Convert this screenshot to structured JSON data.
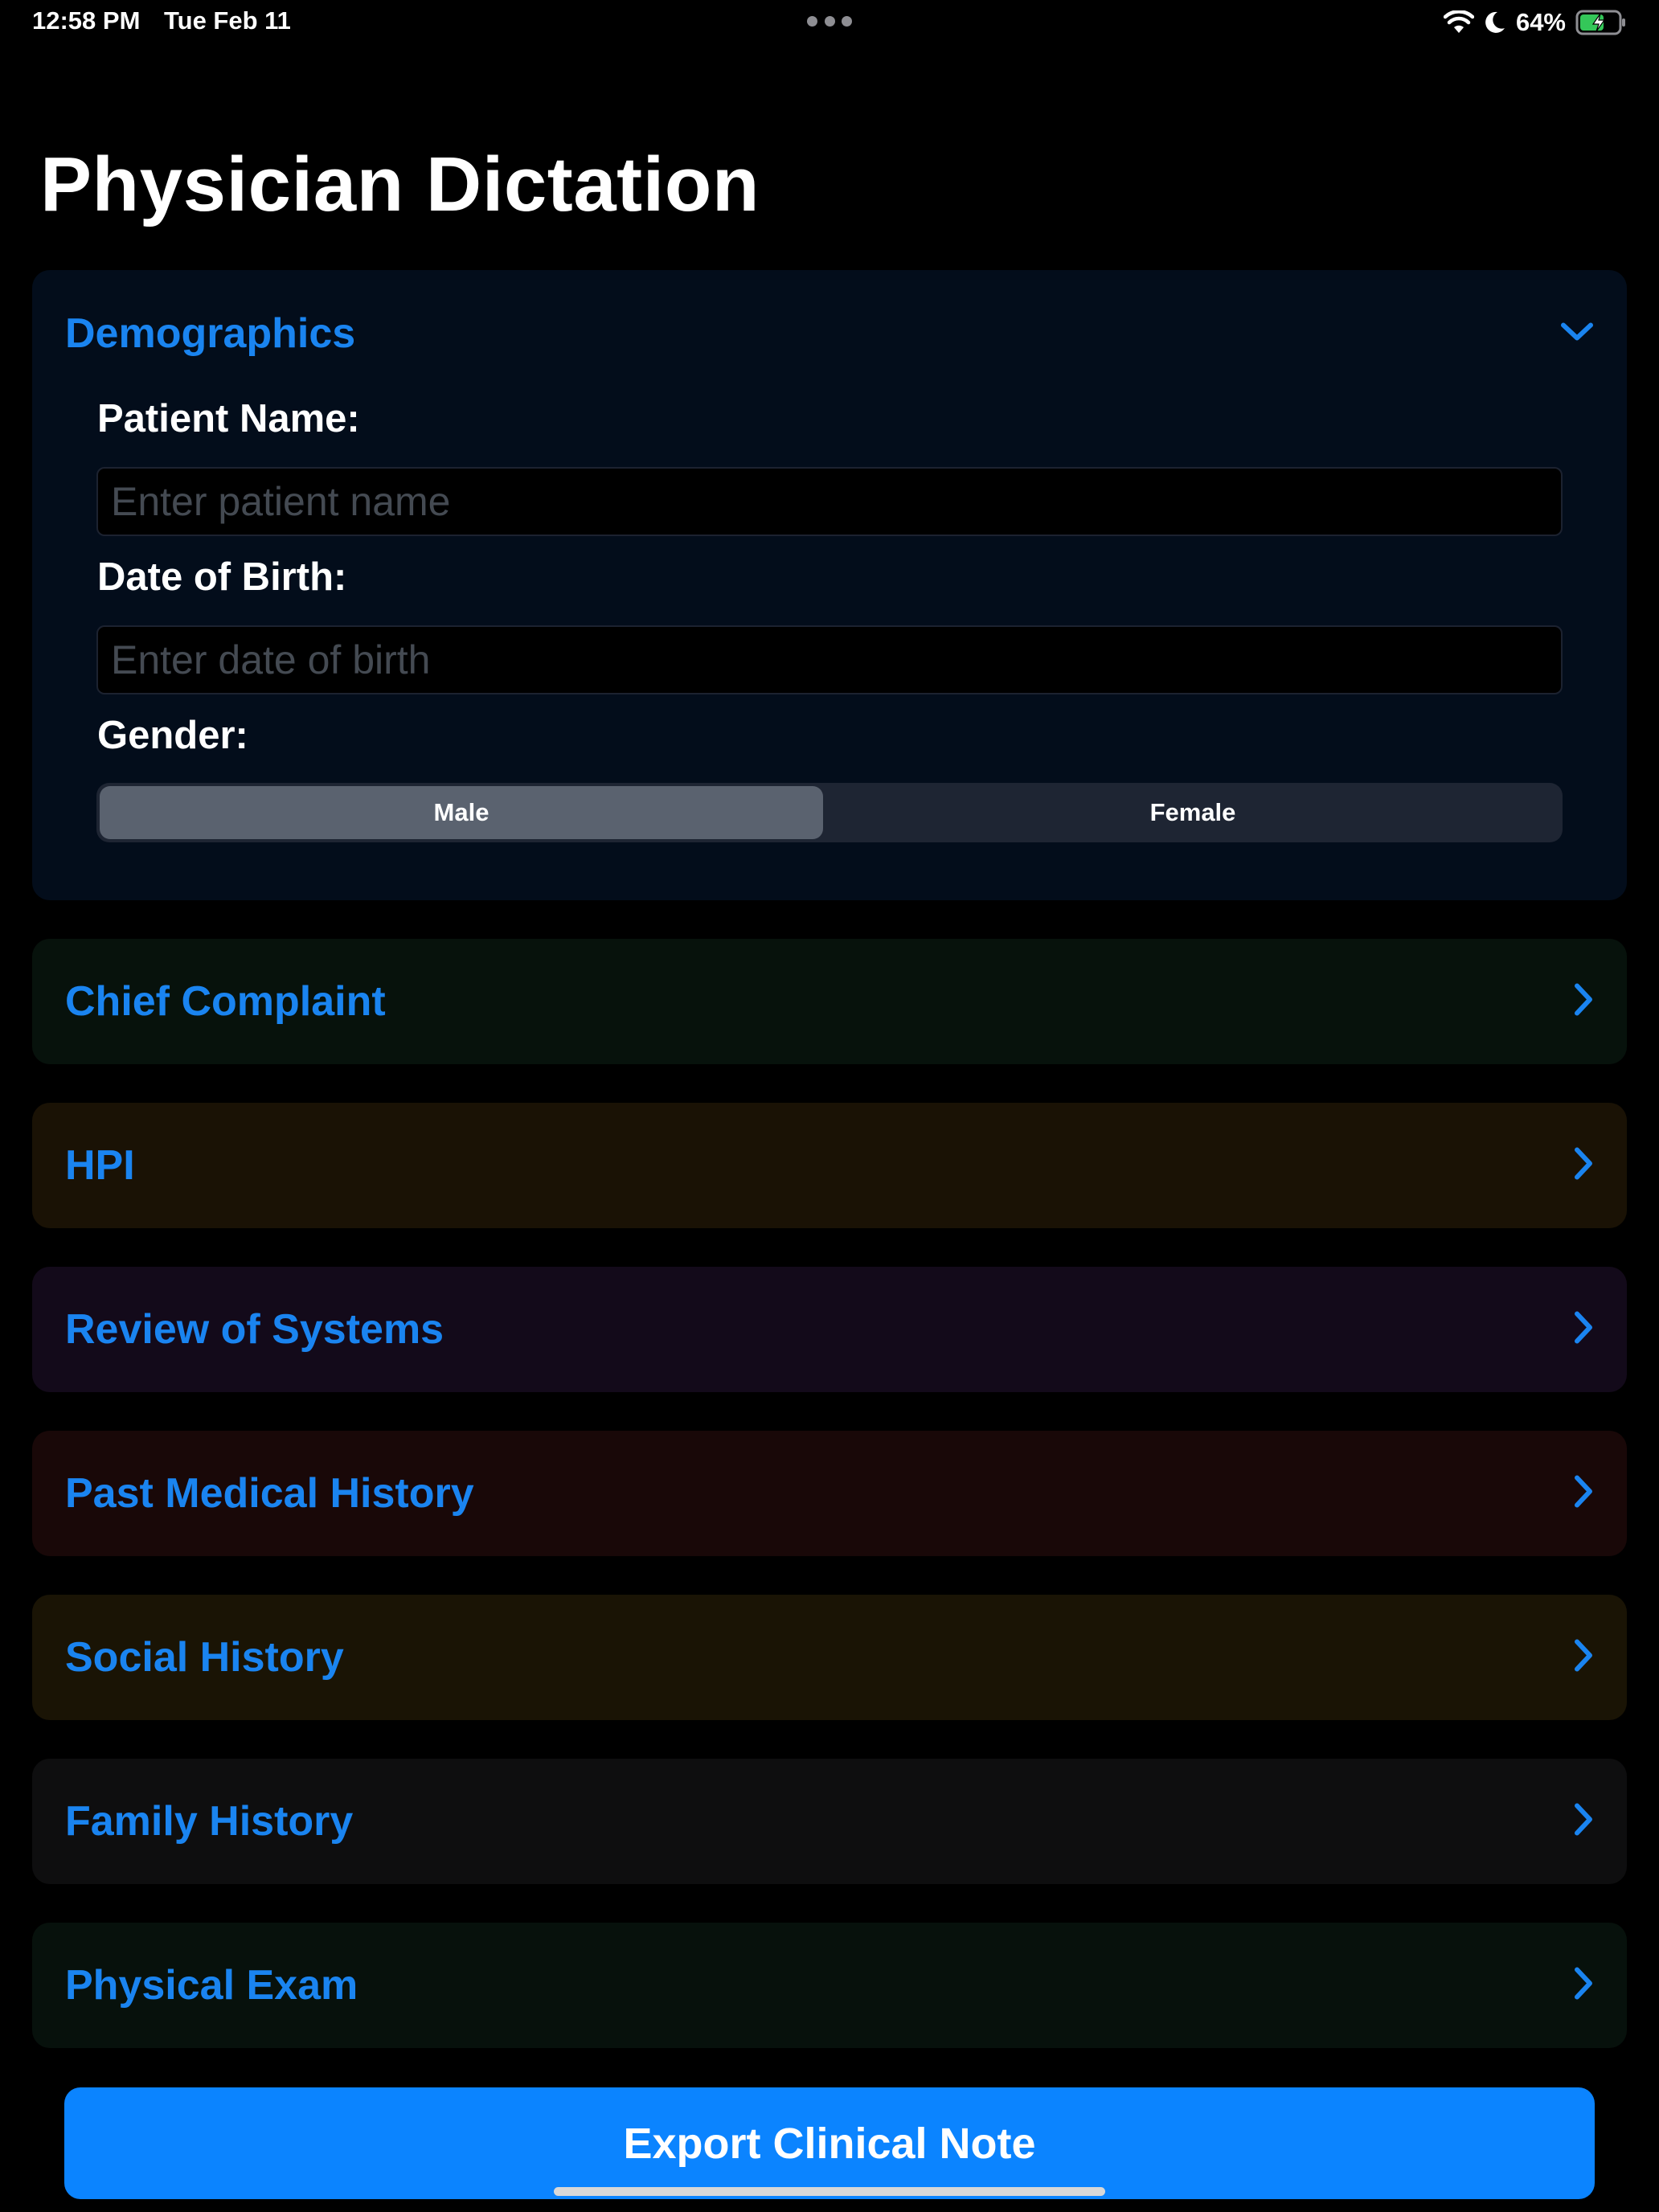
{
  "status_bar": {
    "time": "12:58 PM",
    "date": "Tue Feb 11",
    "battery_percent": "64%",
    "battery_level": 0.64,
    "charging": true,
    "icons": [
      "wifi-icon",
      "moon-icon",
      "battery-icon"
    ]
  },
  "page": {
    "title": "Physician Dictation"
  },
  "demographics": {
    "title": "Demographics",
    "expanded": true,
    "patient_name_label": "Patient Name:",
    "patient_name_placeholder": "Enter patient name",
    "patient_name_value": "",
    "dob_label": "Date of Birth:",
    "dob_placeholder": "Enter date of birth",
    "dob_value": "",
    "gender_label": "Gender:",
    "gender_options": [
      "Male",
      "Female"
    ],
    "gender_selected": "Male"
  },
  "sections": [
    {
      "title": "Chief Complaint",
      "color": "#07120c"
    },
    {
      "title": "HPI",
      "color": "#1a1205"
    },
    {
      "title": "Review of Systems",
      "color": "#130a1a"
    },
    {
      "title": "Past Medical History",
      "color": "#190808"
    },
    {
      "title": "Social History",
      "color": "#1a1405"
    },
    {
      "title": "Family History",
      "color": "#0e0e0f"
    },
    {
      "title": "Physical Exam",
      "color": "#07110c"
    }
  ],
  "export_button": {
    "label": "Export Clinical Note"
  },
  "colors": {
    "background": "#000000",
    "accent": "#0b84ff",
    "section_title": "#1a84f0",
    "demographics_bg": "#030d1b"
  }
}
